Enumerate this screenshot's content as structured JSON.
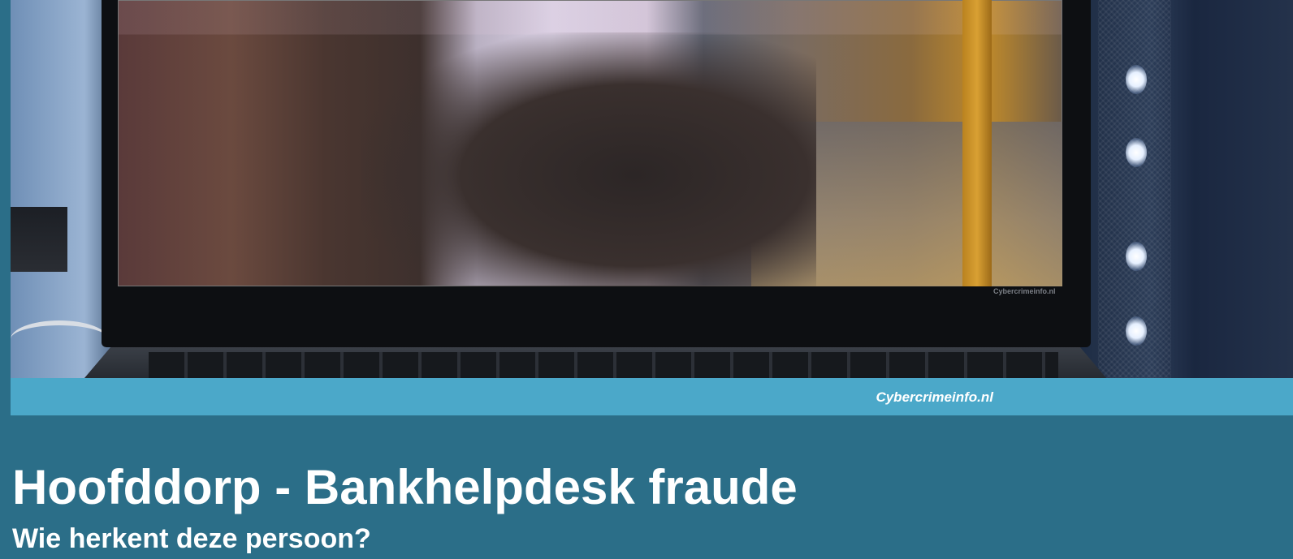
{
  "media": {
    "screen_watermark": "Cybercrimeinfo.nl",
    "caption": "Cybercrimeinfo.nl"
  },
  "article": {
    "title": "Hoofddorp - Bankhelpdesk fraude",
    "subtitle": "Wie herkent deze persoon?"
  },
  "colors": {
    "page_background": "#2b6e88",
    "caption_bar": "#4ba8c9",
    "text": "#ffffff"
  }
}
